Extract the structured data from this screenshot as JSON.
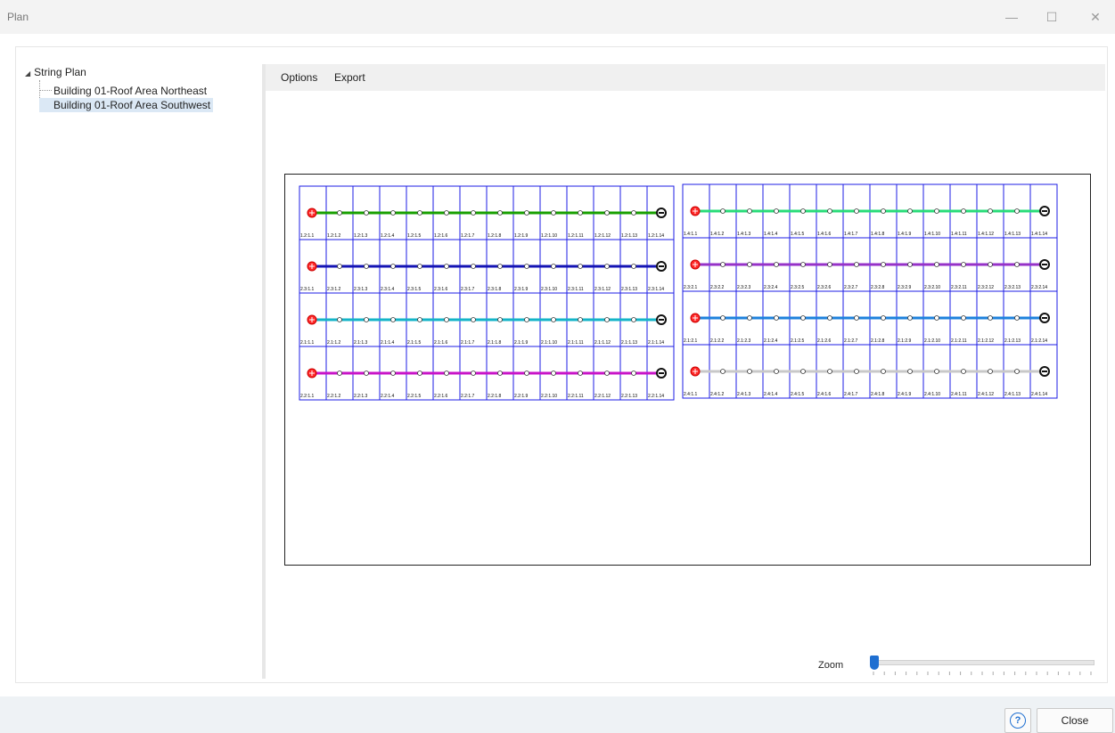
{
  "window": {
    "title": "Plan",
    "minimize_label": "—",
    "maximize_label": "☐",
    "close_label": "✕"
  },
  "tree": {
    "root_label": "String Plan",
    "items": [
      {
        "label": "Building 01-Roof Area Northeast"
      },
      {
        "label": "Building 01-Roof Area Southwest"
      }
    ]
  },
  "menu": {
    "options": "Options",
    "export": "Export"
  },
  "plan": {
    "left_group": {
      "strings": [
        {
          "color": "#18a000",
          "labels": [
            "1.2:1.1",
            "1.2:1.2",
            "1.2:1.3",
            "1.2:1.4",
            "1.2:1.5",
            "1.2:1.6",
            "1.2:1.7",
            "1.2:1.8",
            "1.2:1.9",
            "1.2:1.10",
            "1.2:1.11",
            "1.2:1.12",
            "1.2:1.13",
            "1.2:1.14"
          ]
        },
        {
          "color": "#1414b4",
          "labels": [
            "2.3:1.1",
            "2.3:1.2",
            "2.3:1.3",
            "2.3:1.4",
            "2.3:1.5",
            "2.3:1.6",
            "2.3:1.7",
            "2.3:1.8",
            "2.3:1.9",
            "2.3:1.10",
            "2.3:1.11",
            "2.3:1.12",
            "2.3:1.13",
            "2.3:1.14"
          ]
        },
        {
          "color": "#14b4c8",
          "labels": [
            "2.1:1.1",
            "2.1:1.2",
            "2.1:1.3",
            "2.1:1.4",
            "2.1:1.5",
            "2.1:1.6",
            "2.1:1.7",
            "2.1:1.8",
            "2.1:1.9",
            "2.1:1.10",
            "2.1:1.11",
            "2.1:1.12",
            "2.1:1.13",
            "2.1:1.14"
          ]
        },
        {
          "color": "#c814c8",
          "labels": [
            "2.2:1.1",
            "2.2:1.2",
            "2.2:1.3",
            "2.2:1.4",
            "2.2:1.5",
            "2.2:1.6",
            "2.2:1.7",
            "2.2:1.8",
            "2.2:1.9",
            "2.2:1.10",
            "2.2:1.11",
            "2.2:1.12",
            "2.2:1.13",
            "2.2:1.14"
          ]
        }
      ]
    },
    "right_group": {
      "strings": [
        {
          "color": "#28dc78",
          "labels": [
            "1.4:1.1",
            "1.4:1.2",
            "1.4:1.3",
            "1.4:1.4",
            "1.4:1.5",
            "1.4:1.6",
            "1.4:1.7",
            "1.4:1.8",
            "1.4:1.9",
            "1.4:1.10",
            "1.4:1.11",
            "1.4:1.12",
            "1.4:1.13",
            "1.4:1.14"
          ]
        },
        {
          "color": "#9632c8",
          "labels": [
            "2.3:2.1",
            "2.3:2.2",
            "2.3:2.3",
            "2.3:2.4",
            "2.3:2.5",
            "2.3:2.6",
            "2.3:2.7",
            "2.3:2.8",
            "2.3:2.9",
            "2.3:2.10",
            "2.3:2.11",
            "2.3:2.12",
            "2.3:2.13",
            "2.3:2.14"
          ]
        },
        {
          "color": "#1e82dc",
          "labels": [
            "2.1:2.1",
            "2.1:2.2",
            "2.1:2.3",
            "2.1:2.4",
            "2.1:2.5",
            "2.1:2.6",
            "2.1:2.7",
            "2.1:2.8",
            "2.1:2.9",
            "2.1:2.10",
            "2.1:2.11",
            "2.1:2.12",
            "2.1:2.13",
            "2.1:2.14"
          ]
        },
        {
          "color": "#c8c8c8",
          "labels": [
            "2.4:1.1",
            "2.4:1.2",
            "2.4:1.3",
            "2.4:1.4",
            "2.4:1.5",
            "2.4:1.6",
            "2.4:1.7",
            "2.4:1.8",
            "2.4:1.9",
            "2.4:1.10",
            "2.4:1.11",
            "2.4:1.12",
            "2.4:1.13",
            "2.4:1.14"
          ]
        }
      ]
    }
  },
  "zoom": {
    "label": "Zoom",
    "value": 0
  },
  "footer": {
    "help_label": "?",
    "close_label": "Close"
  }
}
